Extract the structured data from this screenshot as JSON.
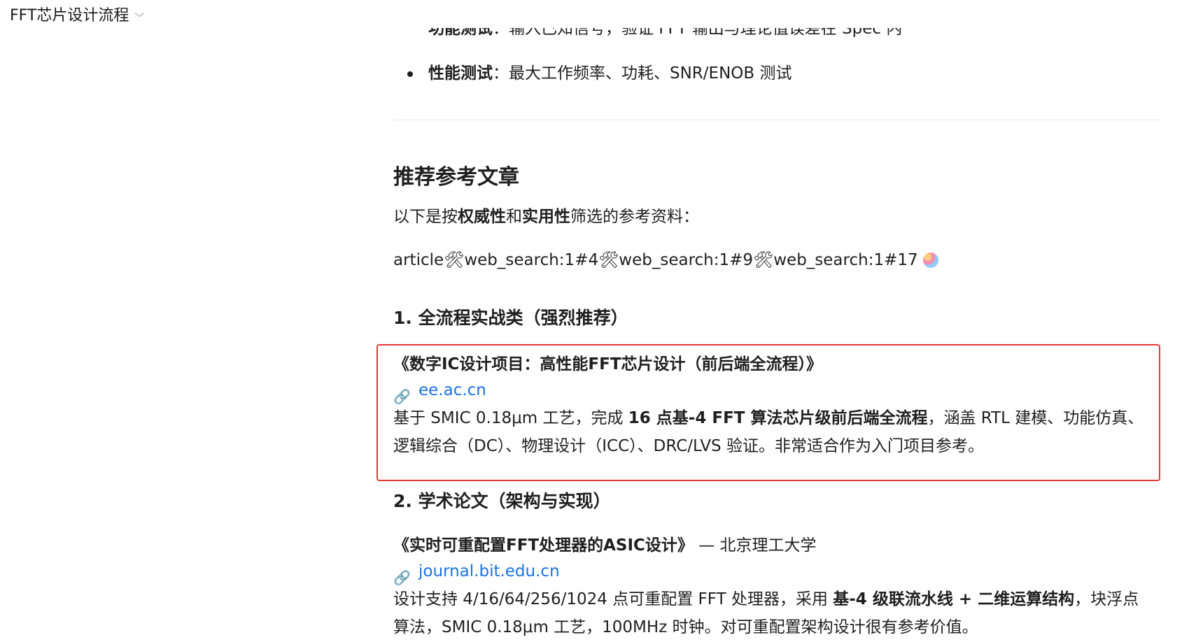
{
  "topbar": {
    "title": "FFT芯片设计流程",
    "chevron_icon": "chevron-down-icon"
  },
  "bullets": [
    {
      "label": "功能测试",
      "text": "：输入已知信号，验证 FFT 输出与理论值误差在 Spec 内"
    },
    {
      "label": "性能测试",
      "text": "：最大工作频率、功耗、SNR/ENOB 测试"
    }
  ],
  "section": {
    "title": "推荐参考文章",
    "intro_prefix": "以下是按",
    "intro_bold1": "权威性",
    "intro_mid": "和",
    "intro_bold2": "实用性",
    "intro_suffix": "筛选的参考资料：",
    "citation_line": "article🛠web_search:1#4🛠web_search:1#9🛠web_search:1#17"
  },
  "groups": [
    {
      "heading": "1. 全流程实战类（强烈推荐）",
      "item": {
        "title": "《数字IC设计项目：高性能FFT芯片设计（前后端全流程）》",
        "link": "ee.ac.cn",
        "desc_prefix": "基于 SMIC 0.18μm 工艺，完成 ",
        "desc_bold": "16 点基-4 FFT 算法芯片级前后端全流程",
        "desc_suffix": "，涵盖 RTL 建模、功能仿真、",
        "desc_line2": "逻辑综合（DC）、物理设计（ICC）、DRC/LVS 验证。非常适合作为入门项目参考。"
      }
    },
    {
      "heading": "2. 学术论文（架构与实现）",
      "item": {
        "title": "《实时可重配置FFT处理器的ASIC设计》",
        "title_suffix": " — 北京理工大学",
        "link": "journal.bit.edu.cn",
        "desc_prefix": "设计支持 4/16/64/256/1024 点可重配置 FFT 处理器，采用 ",
        "desc_bold": "基-4 级联流水线 + 二维运算结构",
        "desc_suffix": "，块浮点",
        "desc_line2": "算法，SMIC 0.18μm 工艺，100MHz 时钟。对可重配置架构设计很有参考价值。"
      }
    }
  ],
  "colors": {
    "link": "#1a73e8",
    "highlight_border": "#e53935"
  }
}
